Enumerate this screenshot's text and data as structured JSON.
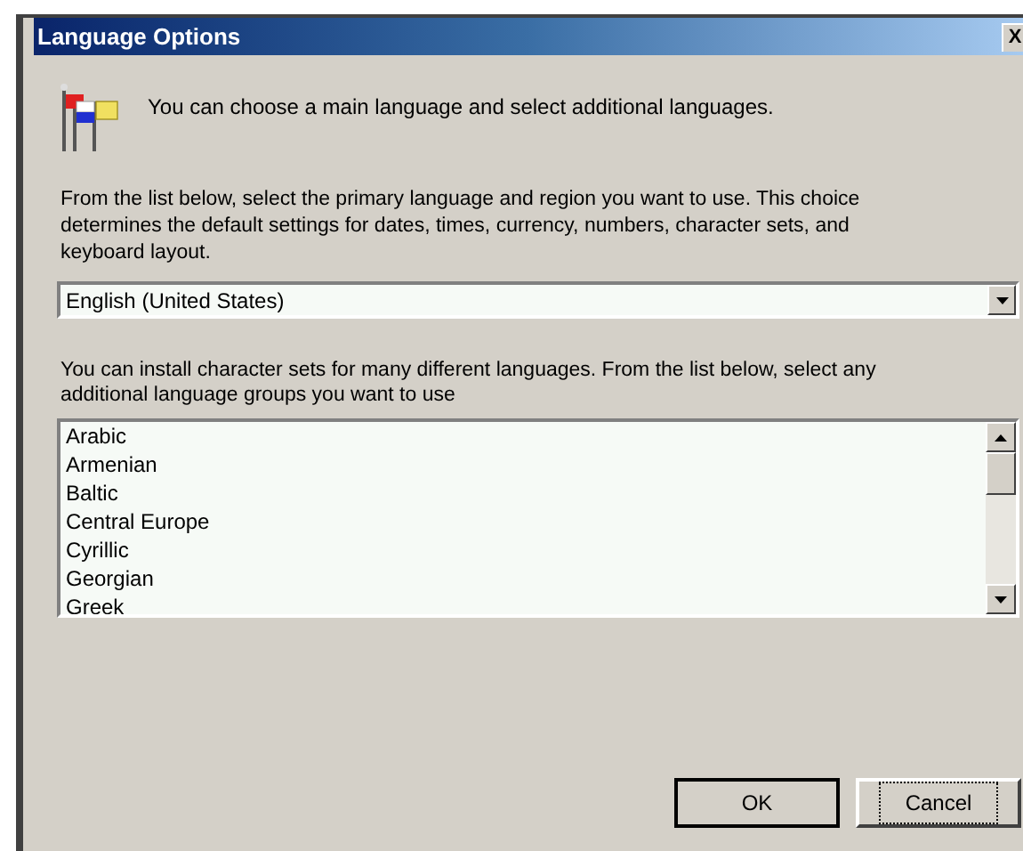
{
  "window": {
    "title": "Language Options",
    "close": "X"
  },
  "intro": "You can choose a main language and select additional languages.",
  "primary_text": [
    "From the list below, select the primary language and region you want to use. This choice",
    "determines the default settings for dates, times, currency, numbers, character sets, and",
    "keyboard layout."
  ],
  "primary_select": {
    "value": "English (United States)"
  },
  "groups_text": [
    "You can install character sets for many different languages. From the list below, select any",
    "additional language groups you want to use"
  ],
  "groups_list": {
    "items": [
      {
        "label": "Arabic",
        "selected": false
      },
      {
        "label": "Armenian",
        "selected": false
      },
      {
        "label": "Baltic",
        "selected": false
      },
      {
        "label": "Central Europe",
        "selected": false
      },
      {
        "label": "Cyrillic",
        "selected": false
      },
      {
        "label": "Georgian",
        "selected": false
      },
      {
        "label": "Greek",
        "selected": false
      }
    ]
  },
  "buttons": [
    {
      "label": "OK",
      "default": true,
      "focused": false
    },
    {
      "label": "Cancel",
      "default": false,
      "focused": true
    }
  ]
}
